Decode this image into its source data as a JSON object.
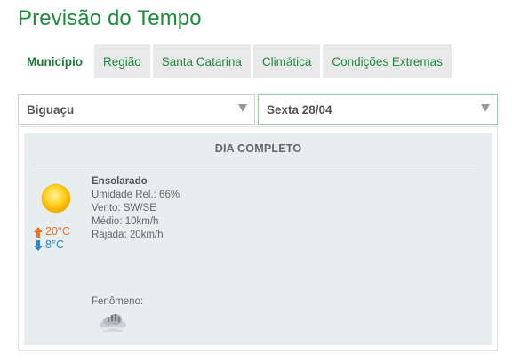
{
  "page": {
    "title": "Previsão do Tempo"
  },
  "tabs": [
    {
      "label": "Município",
      "active": true
    },
    {
      "label": "Região",
      "active": false
    },
    {
      "label": "Santa Catarina",
      "active": false
    },
    {
      "label": "Climática",
      "active": false
    },
    {
      "label": "Condições Extremas",
      "active": false
    }
  ],
  "selects": {
    "city": {
      "value": "Biguaçu"
    },
    "day": {
      "value": "Sexta 28/04"
    }
  },
  "forecast": {
    "section_title": "DIA COMPLETO",
    "icon": "sun-icon",
    "temp_max": "20°C",
    "temp_min": "8°C",
    "condition": "Ensolarado",
    "humidity": "Umidade Rel.: 66%",
    "wind": "Vento: SW/SE",
    "avg_speed": "Médio: 10km/h",
    "gust": "Rajada: 20km/h",
    "phenomenon_label": "Fenômeno:",
    "phenomenon_icon": "fog-cloud-icon"
  },
  "colors": {
    "brand_green": "#1f8a3c",
    "temp_max": "#f07020",
    "temp_min": "#2e86d0",
    "panel_bg": "#e7eef0"
  }
}
